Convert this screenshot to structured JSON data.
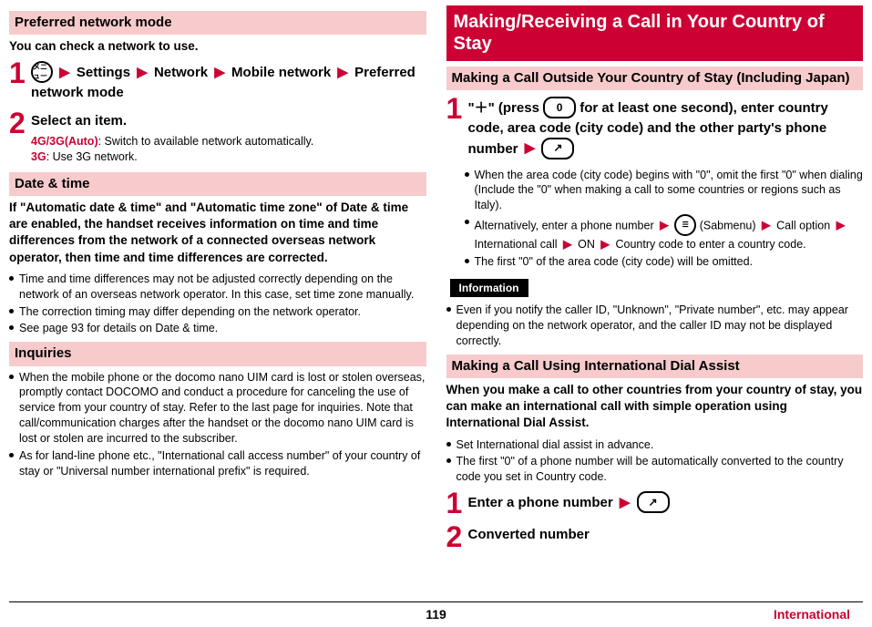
{
  "left": {
    "preferred_mode": {
      "title": "Preferred network mode",
      "lead": "You can check a network to use.",
      "step1_icon": "メニュー",
      "nav1": "Settings",
      "nav2": "Network",
      "nav3": "Mobile network",
      "nav4": "Preferred network mode",
      "step2_title": "Select an item.",
      "opt1_label": "4G/3G(Auto)",
      "opt1_desc": ": Switch to available network automatically.",
      "opt2_label": "3G",
      "opt2_desc": ": Use 3G network."
    },
    "date_time": {
      "title": "Date & time",
      "lead": "If \"Automatic date & time\" and \"Automatic time zone\" of Date & time are enabled, the handset receives information on time and time differences from the network of a connected overseas network operator, then time and time differences are corrected.",
      "b1": "Time and time differences may not be adjusted correctly depending on the network of an overseas network operator. In this case, set time zone manually.",
      "b2": "The correction timing may differ depending on the network operator.",
      "b3": "See page 93 for details on Date & time."
    },
    "inquiries": {
      "title": "Inquiries",
      "b1": "When the mobile phone or the docomo nano UIM card is lost or stolen overseas, promptly contact DOCOMO and conduct a procedure for canceling the use of service from your country of stay. Refer to the last page for inquiries. Note that call/communication charges after the handset or the docomo nano UIM card is lost or stolen are incurred to the subscriber.",
      "b2": "As for land-line phone etc., \"International call access number\" of your country of stay or \"Universal number international prefix\" is required."
    }
  },
  "right": {
    "main_title": "Making/Receiving a Call in Your Country of Stay",
    "outside": {
      "title": "Making a Call Outside Your Country of Stay (Including Japan)",
      "step1_a": "\"＋\" (press",
      "step1_key": "0",
      "step1_b": "for at least one second), enter country code, area code (city code) and the other party's phone number",
      "call_icon": "↗",
      "b1": "When the area code (city code) begins with \"0\", omit the first \"0\" when dialing (Include the \"0\" when making a call to some countries or regions such as Italy).",
      "b2a": "Alternatively, enter a phone number",
      "b2_submenu_icon": "☰",
      "b2_submenu": "(Sabmenu)",
      "b2b": "Call option",
      "b2c": "International call",
      "b2d": "ON",
      "b2e": "Country code to enter a country code.",
      "b3": "The first \"0\" of the area code (city code) will be omitted.",
      "info_tag": "Information",
      "info_b1": "Even if you notify the caller ID, \"Unknown\", \"Private number\", etc. may appear depending on the network operator, and the caller ID may not be displayed correctly."
    },
    "dial_assist": {
      "title": "Making a Call Using International Dial Assist",
      "lead": "When you make a call to other countries from your country of stay, you can make an international call with simple operation using International Dial Assist.",
      "b1": "Set International dial assist in advance.",
      "b2": "The first \"0\" of a phone number will be automatically converted to the country code you set in Country code.",
      "step1": "Enter a phone number",
      "step2": "Converted number"
    }
  },
  "footer": {
    "page": "119",
    "section": "International"
  }
}
